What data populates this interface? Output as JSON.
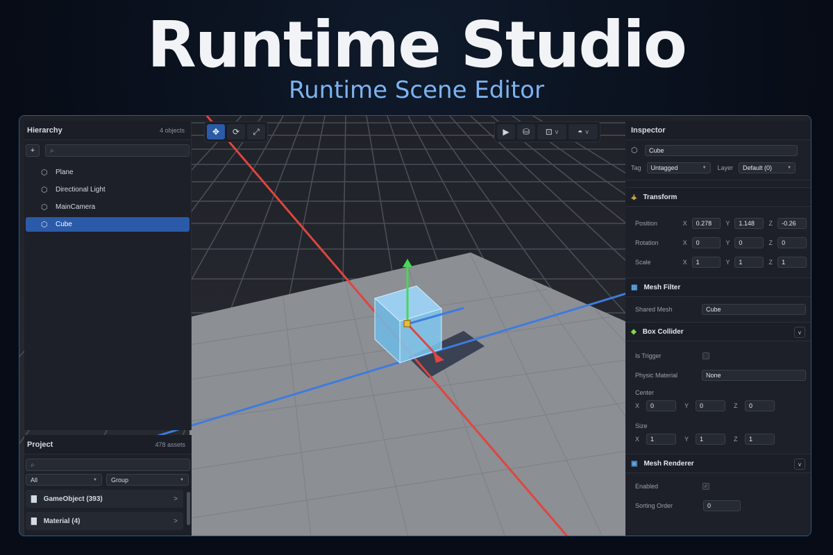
{
  "hero": {
    "title": "Runtime Studio",
    "subtitle": "Runtime Scene Editor"
  },
  "hierarchy": {
    "title": "Hierarchy",
    "count": "4 objects",
    "add_label": "+",
    "items": [
      {
        "label": "Plane",
        "selected": false
      },
      {
        "label": "Directional Light",
        "selected": false
      },
      {
        "label": "MainCamera",
        "selected": false
      },
      {
        "label": "Cube",
        "selected": true
      }
    ]
  },
  "project": {
    "title": "Project",
    "count": "478 assets",
    "filter_all": "All",
    "filter_group": "Group",
    "folders": [
      {
        "label": "GameObject (393)"
      },
      {
        "label": "Material (4)"
      }
    ]
  },
  "inspector": {
    "title": "Inspector",
    "object_name": "Cube",
    "tag_label": "Tag",
    "tag_value": "Untagged",
    "layer_label": "Layer",
    "layer_value": "Default (0)",
    "transform": {
      "title": "Transform",
      "position": {
        "label": "Position",
        "x": "0.278",
        "y": "1.148",
        "z": "-0.26"
      },
      "rotation": {
        "label": "Rotation",
        "x": "0",
        "y": "0",
        "z": "0"
      },
      "scale": {
        "label": "Scale",
        "x": "1",
        "y": "1",
        "z": "1"
      }
    },
    "mesh_filter": {
      "title": "Mesh Filter",
      "shared_mesh_label": "Shared Mesh",
      "shared_mesh_value": "Cube"
    },
    "box_collider": {
      "title": "Box Collider",
      "is_trigger_label": "Is Trigger",
      "physic_material_label": "Physic Material",
      "physic_material_value": "None",
      "center_label": "Center",
      "center": {
        "x": "0",
        "y": "0",
        "z": "0"
      },
      "size_label": "Size",
      "size": {
        "x": "1",
        "y": "1",
        "z": "1"
      }
    },
    "mesh_renderer": {
      "title": "Mesh Renderer",
      "enabled_label": "Enabled",
      "sorting_order_label": "Sorting Order",
      "sorting_order_value": "0"
    }
  },
  "axes": {
    "x": "X",
    "y": "Y",
    "z": "Z"
  },
  "chevron": "v",
  "folder_arrow": ">",
  "colors": {
    "accent": "#2b5aa8",
    "frame": "#2f5c8c",
    "axis_x": "#e0453f",
    "axis_y": "#4ad65a",
    "axis_z": "#3f7bdf",
    "selection": "#8fd3ff"
  }
}
